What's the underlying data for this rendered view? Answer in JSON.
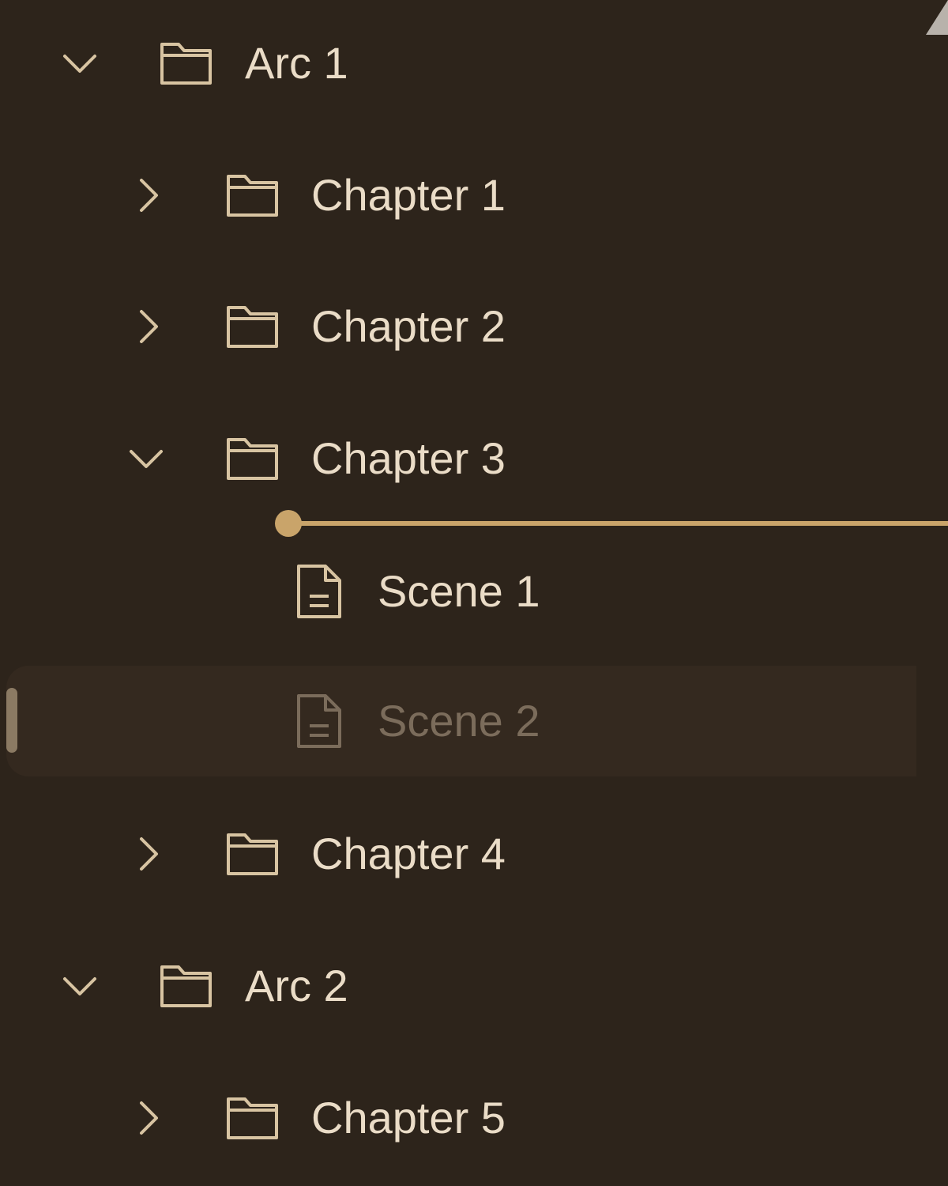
{
  "tree": {
    "items": [
      {
        "label": "Arc 1",
        "type": "folder",
        "expanded": true,
        "depth": 0
      },
      {
        "label": "Chapter 1",
        "type": "folder",
        "expanded": false,
        "depth": 1
      },
      {
        "label": "Chapter 2",
        "type": "folder",
        "expanded": false,
        "depth": 1
      },
      {
        "label": "Chapter 3",
        "type": "folder",
        "expanded": true,
        "depth": 1
      },
      {
        "label": "Scene 1",
        "type": "document",
        "depth": 2
      },
      {
        "label": "Scene 2",
        "type": "document",
        "depth": 2,
        "selected": true,
        "dimmed": true
      },
      {
        "label": "Chapter 4",
        "type": "folder",
        "expanded": false,
        "depth": 1
      },
      {
        "label": "Arc 2",
        "type": "folder",
        "expanded": true,
        "depth": 0
      },
      {
        "label": "Chapter 5",
        "type": "folder",
        "expanded": false,
        "depth": 1
      }
    ]
  },
  "icons": {
    "expanded": "chevron-down-icon",
    "collapsed": "chevron-right-icon",
    "folder": "folder-icon",
    "document": "document-icon"
  },
  "colors": {
    "background": "#2d241b",
    "selected_row": "#34291f",
    "text": "#eadcc7",
    "text_dim": "#7b6c5b",
    "icon": "#d8c4a2",
    "drop_indicator": "#c9a46a"
  }
}
